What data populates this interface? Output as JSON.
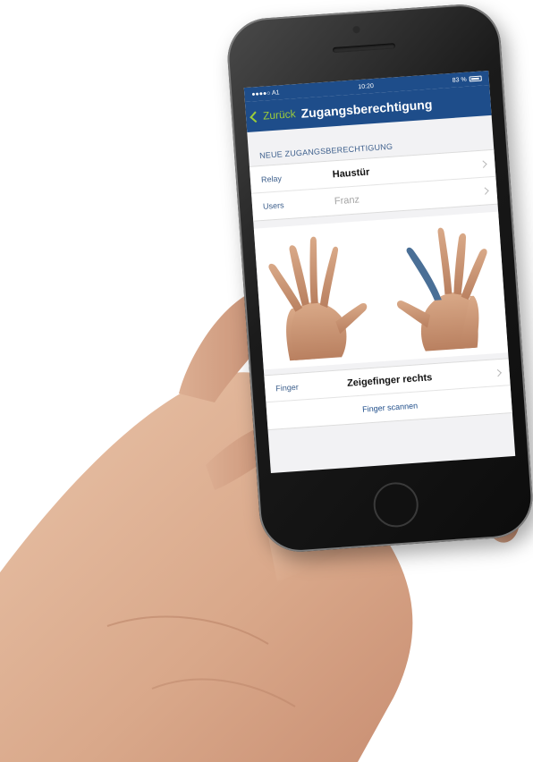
{
  "status_bar": {
    "carrier": "●●●●○ A1",
    "time": "10:20",
    "battery": "83 %"
  },
  "nav": {
    "back_label": "Zurück",
    "title": "Zugangsberechtigung"
  },
  "section": {
    "header": "NEUE ZUGANGSBERECHTIGUNG"
  },
  "rows": [
    {
      "label": "Relay",
      "value": "Haustür"
    },
    {
      "label": "Users",
      "value": "Franz"
    }
  ],
  "finger_row": {
    "label": "Finger",
    "value": "Zeigefinger rechts"
  },
  "scan_button": {
    "label": "Finger scannen"
  },
  "colors": {
    "nav_background": "#1e4d8a",
    "accent_back": "#9ccc3a",
    "highlight_finger": "#4a6f96",
    "nail_polish": "#e8205a"
  },
  "icons": {
    "back": "chevron-left-icon",
    "disclosure": "chevron-right-icon",
    "wifi": "wifi-icon",
    "battery": "battery-icon"
  },
  "selected_finger": "right-index"
}
